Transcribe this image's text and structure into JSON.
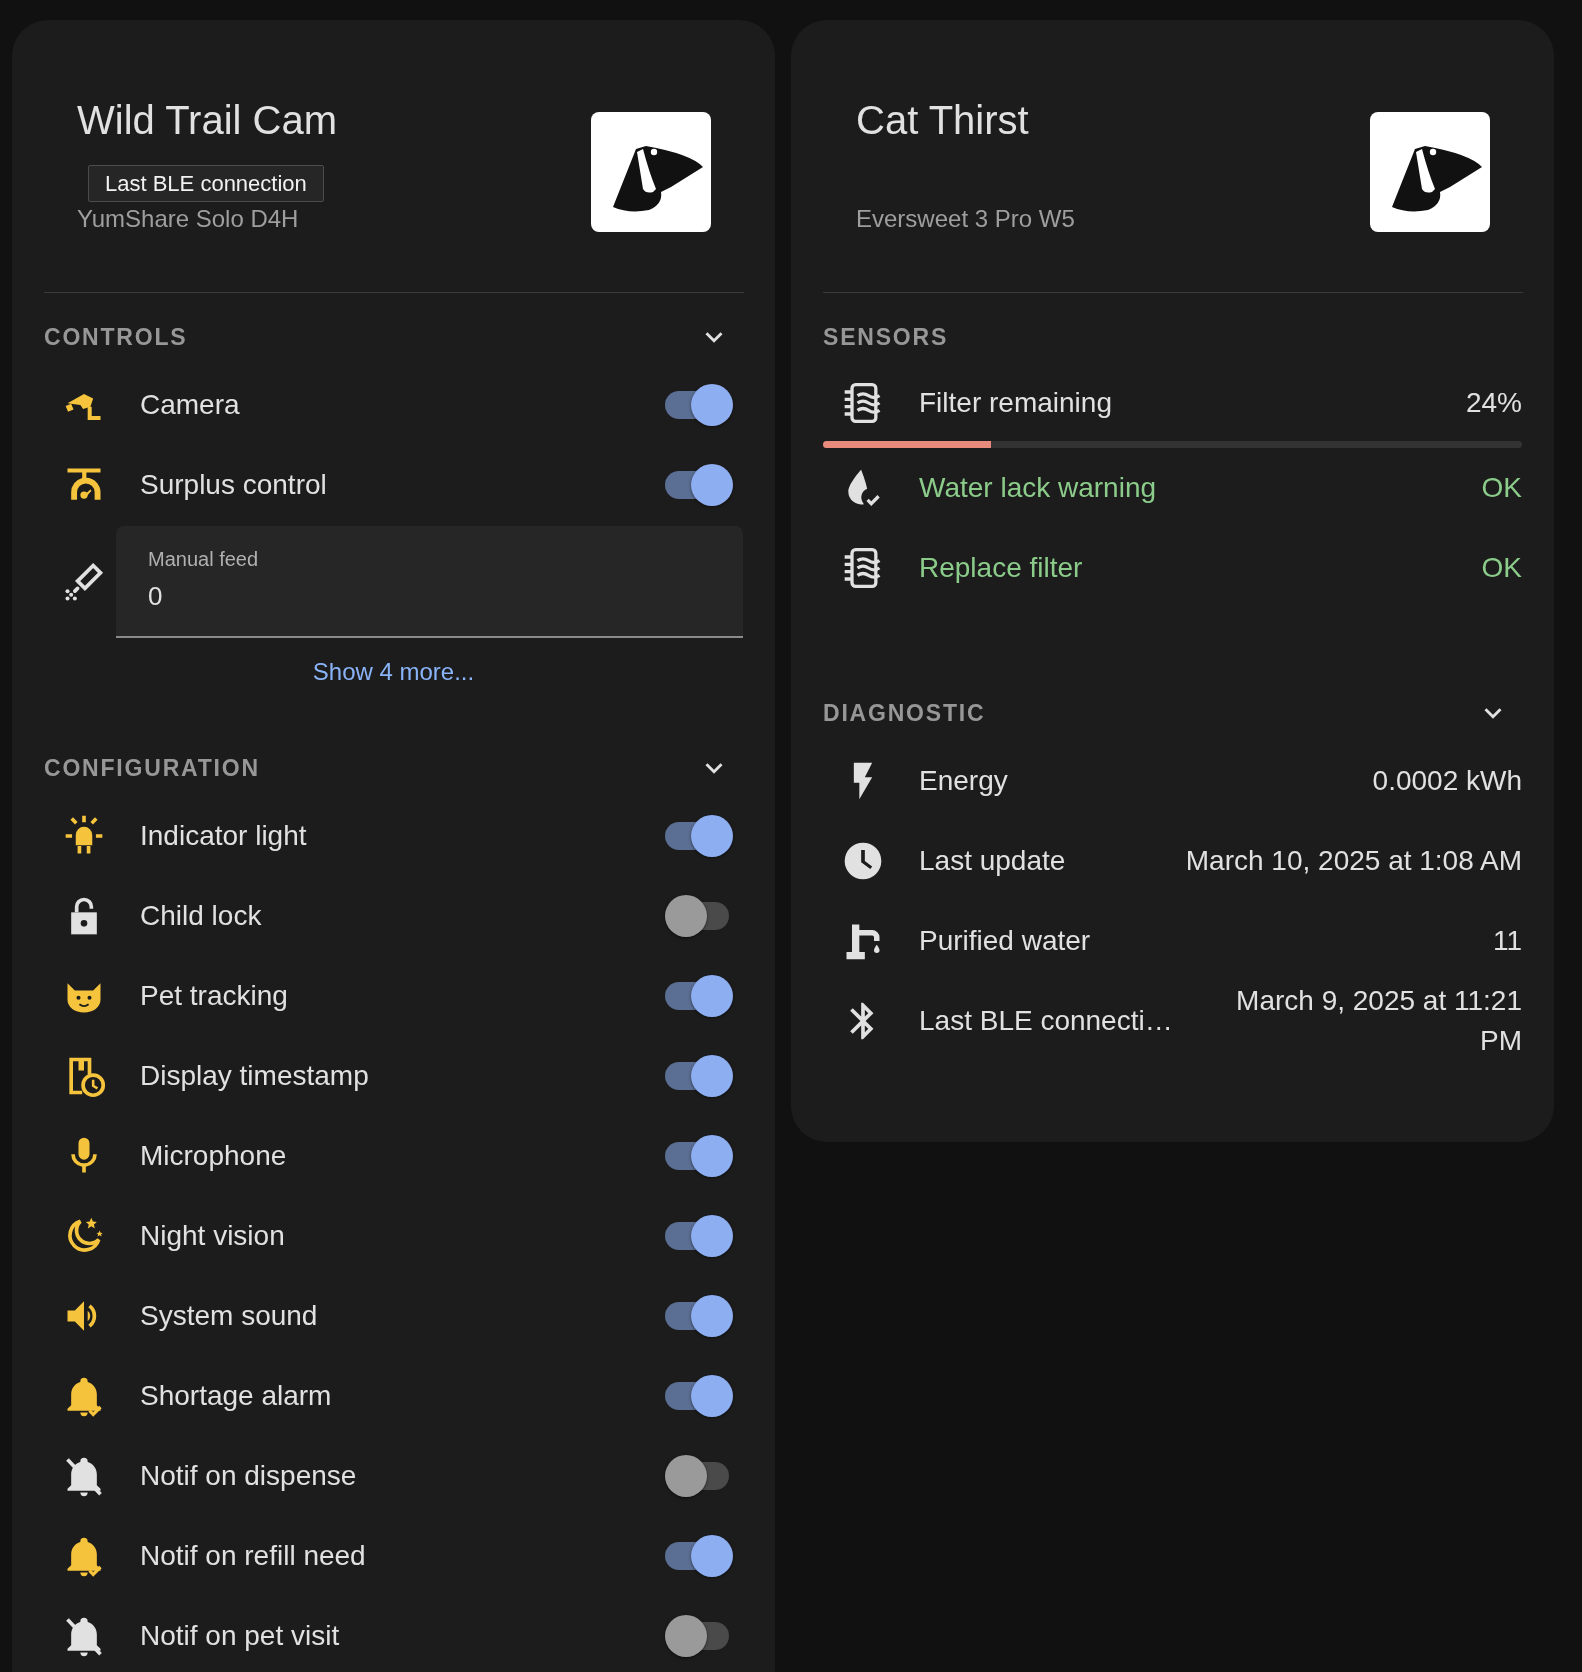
{
  "cards": [
    {
      "title": "Wild Trail Cam",
      "subtitle": "YumShare Solo D4H",
      "tooltip": "Last BLE connection",
      "sections": [
        {
          "heading": "CONTROLS",
          "expandable": true,
          "rows": [
            {
              "kind": "toggle",
              "label": "Camera",
              "on": true
            },
            {
              "kind": "toggle",
              "label": "Surplus control",
              "on": true
            },
            {
              "kind": "number",
              "label": "Manual feed",
              "value": "0"
            }
          ],
          "more": "Show 4 more..."
        },
        {
          "heading": "CONFIGURATION",
          "expandable": true,
          "rows": [
            {
              "kind": "toggle",
              "label": "Indicator light",
              "on": true
            },
            {
              "kind": "toggle",
              "label": "Child lock",
              "on": false
            },
            {
              "kind": "toggle",
              "label": "Pet tracking",
              "on": true
            },
            {
              "kind": "toggle",
              "label": "Display timestamp",
              "on": true
            },
            {
              "kind": "toggle",
              "label": "Microphone",
              "on": true
            },
            {
              "kind": "toggle",
              "label": "Night vision",
              "on": true
            },
            {
              "kind": "toggle",
              "label": "System sound",
              "on": true
            },
            {
              "kind": "toggle",
              "label": "Shortage alarm",
              "on": true
            },
            {
              "kind": "toggle",
              "label": "Notif on dispense",
              "on": false
            },
            {
              "kind": "toggle",
              "label": "Notif on refill need",
              "on": true
            },
            {
              "kind": "toggle",
              "label": "Notif on pet visit",
              "on": false
            }
          ]
        }
      ]
    },
    {
      "title": "Cat Thirst",
      "subtitle": "Eversweet 3 Pro W5",
      "sections": [
        {
          "heading": "SENSORS",
          "expandable": false,
          "rows": [
            {
              "kind": "level",
              "label": "Filter remaining",
              "value": "24%",
              "level": 0.24
            },
            {
              "kind": "status",
              "label": "Water lack warning",
              "value": "OK"
            },
            {
              "kind": "status",
              "label": "Replace filter",
              "value": "OK"
            }
          ]
        },
        {
          "heading": "DIAGNOSTIC",
          "expandable": true,
          "rows": [
            {
              "kind": "value",
              "label": "Energy",
              "value": "0.0002 kWh"
            },
            {
              "kind": "value",
              "label": "Last update",
              "value": "March 10, 2025 at 1:08 AM"
            },
            {
              "kind": "value",
              "label": "Purified water",
              "value": "11"
            },
            {
              "kind": "value",
              "label": "Last BLE connecti…",
              "value": "March 9, 2025 at 11:21 PM"
            }
          ]
        }
      ]
    }
  ]
}
